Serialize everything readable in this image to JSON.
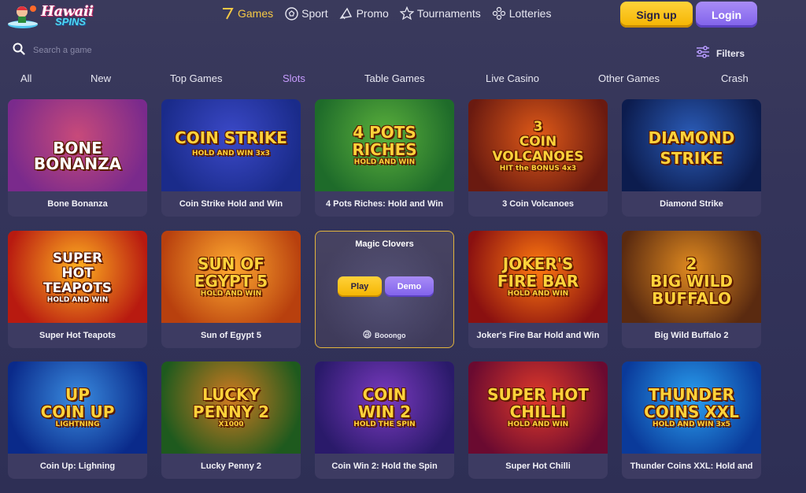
{
  "header": {
    "logo": {
      "line1": "Hawaii",
      "line2": "SPINS"
    },
    "nav": [
      {
        "label": "Games",
        "icon": "seven-icon",
        "active": true
      },
      {
        "label": "Sport",
        "icon": "soccer-ball-icon",
        "active": false
      },
      {
        "label": "Promo",
        "icon": "megaphone-icon",
        "active": false
      },
      {
        "label": "Tournaments",
        "icon": "star-icon",
        "active": false
      },
      {
        "label": "Lotteries",
        "icon": "lottery-icon",
        "active": false
      }
    ],
    "signup_label": "Sign up",
    "login_label": "Login"
  },
  "search": {
    "placeholder": "Search a game",
    "value": ""
  },
  "filters_label": "Filters",
  "categories": [
    {
      "label": "All",
      "active": false
    },
    {
      "label": "New",
      "active": false
    },
    {
      "label": "Top Games",
      "active": false
    },
    {
      "label": "Slots",
      "active": true
    },
    {
      "label": "Table Games",
      "active": false
    },
    {
      "label": "Live Casino",
      "active": false
    },
    {
      "label": "Other Games",
      "active": false
    },
    {
      "label": "Crash",
      "active": false
    }
  ],
  "games": [
    {
      "title": "Bone Bonanza",
      "art_lines": [
        "BONE BONANZA"
      ],
      "bg": [
        "#7a2a8c",
        "#c84a7a"
      ],
      "fg": "#ffffff"
    },
    {
      "title": "Coin Strike Hold and Win",
      "art_lines": [
        "COIN STRIKE",
        "HOLD AND WIN 3x3"
      ],
      "bg": [
        "#1a2b8a",
        "#3b49c8"
      ],
      "fg": "#ffd23a"
    },
    {
      "title": "4 Pots Riches: Hold and Win",
      "art_lines": [
        "4 POTS",
        "RICHES",
        "HOLD AND WIN"
      ],
      "bg": [
        "#1e6b2a",
        "#5bb03c"
      ],
      "fg": "#ffd23a"
    },
    {
      "title": "3 Coin Volcanoes",
      "art_lines": [
        "3",
        "COIN",
        "VOLCANOES",
        "HIT the BONUS 4x3"
      ],
      "bg": [
        "#6a1a10",
        "#e05a18"
      ],
      "fg": "#ffd23a"
    },
    {
      "title": "Diamond Strike",
      "art_lines": [
        "DIAMOND",
        "STRIKE"
      ],
      "bg": [
        "#0c1c4e",
        "#2b5cb8"
      ],
      "fg": "#ffd23a"
    },
    {
      "title": "Super Hot Teapots",
      "art_lines": [
        "SUPER",
        "HOT",
        "TEAPOTS",
        "HOLD AND WIN"
      ],
      "bg": [
        "#b81a10",
        "#ffb020"
      ],
      "fg": "#ffffff"
    },
    {
      "title": "Sun of Egypt 5",
      "art_lines": [
        "SUN OF",
        "EGYPT 5",
        "HOLD AND WIN"
      ],
      "bg": [
        "#b8400e",
        "#ffaa30"
      ],
      "fg": "#ffd23a"
    },
    {
      "title": "Magic Clovers",
      "hover": true,
      "play_label": "Play",
      "demo_label": "Demo",
      "provider": "Booongo"
    },
    {
      "title": "Joker's Fire Bar Hold and Win",
      "art_lines": [
        "JOKER'S",
        "FIRE BAR",
        "HOLD AND WIN"
      ],
      "bg": [
        "#8a1010",
        "#ff7a10"
      ],
      "fg": "#ffd23a"
    },
    {
      "title": "Big Wild Buffalo 2",
      "art_lines": [
        "2",
        "BIG WILD",
        "BUFFALO"
      ],
      "bg": [
        "#5a2a10",
        "#e08a20"
      ],
      "fg": "#ffd23a"
    },
    {
      "title": "Coin Up: Lighning",
      "art_lines": [
        "UP",
        "COIN UP",
        "LIGHTNING"
      ],
      "bg": [
        "#0a2a8a",
        "#3a8ce0"
      ],
      "fg": "#ffd23a"
    },
    {
      "title": "Lucky Penny 2",
      "art_lines": [
        "LUCKY",
        "PENNY 2",
        "X1000"
      ],
      "bg": [
        "#1e5a1e",
        "#d07a20"
      ],
      "fg": "#ffd23a"
    },
    {
      "title": "Coin Win 2: Hold the Spin",
      "art_lines": [
        "COIN",
        "WIN 2",
        "HOLD THE SPIN"
      ],
      "bg": [
        "#2a1a6a",
        "#7a3ac0"
      ],
      "fg": "#ffd23a"
    },
    {
      "title": "Super Hot Chilli",
      "art_lines": [
        "SUPER HOT",
        "CHILLI",
        "HOLD AND WIN"
      ],
      "bg": [
        "#6a0a30",
        "#e03a2a"
      ],
      "fg": "#ffd23a"
    },
    {
      "title": "Thunder Coins XXL: Hold and",
      "art_lines": [
        "THUNDER",
        "COINS XXL",
        "HOLD AND WIN 3x5"
      ],
      "bg": [
        "#0a3a9a",
        "#2aa0f0"
      ],
      "fg": "#ffd23a"
    }
  ]
}
